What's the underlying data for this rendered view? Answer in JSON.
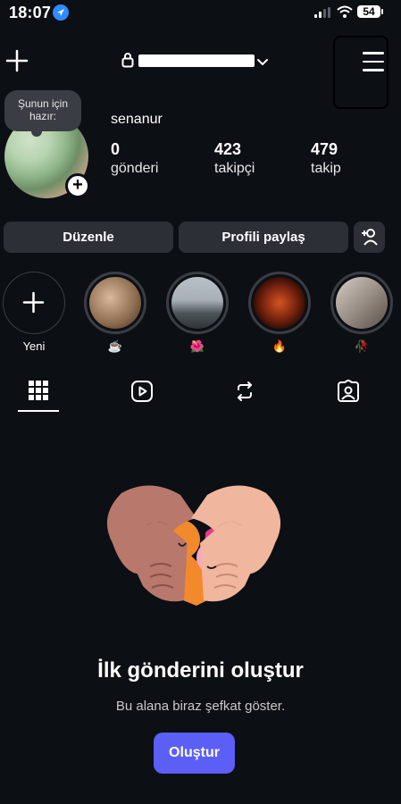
{
  "status_bar": {
    "time": "18:07",
    "battery": "54"
  },
  "header": {
    "username_redacted": true
  },
  "profile": {
    "note": "Şunun için hazır:",
    "name": "senanur",
    "stats": [
      {
        "value": "0",
        "label": "gönderi"
      },
      {
        "value": "423",
        "label": "takipçi"
      },
      {
        "value": "479",
        "label": "takip"
      }
    ]
  },
  "actions": {
    "edit_label": "Düzenle",
    "share_label": "Profili paylaş"
  },
  "highlights": {
    "new_label": "Yeni",
    "items": [
      {
        "label": "☕",
        "color": "#8b6a4e"
      },
      {
        "label": "🌺",
        "color": "#6d7780"
      },
      {
        "label": "🔥",
        "color": "#7a2410"
      },
      {
        "label": "🥀",
        "color": "#9a8f87"
      }
    ]
  },
  "empty_state": {
    "title": "İlk gönderini oluştur",
    "subtitle": "Bu alana biraz şefkat göster.",
    "button_label": "Oluştur"
  },
  "colors": {
    "accent": "#5b5ff5",
    "background": "#0c0f14",
    "surface": "#2c2f35"
  }
}
